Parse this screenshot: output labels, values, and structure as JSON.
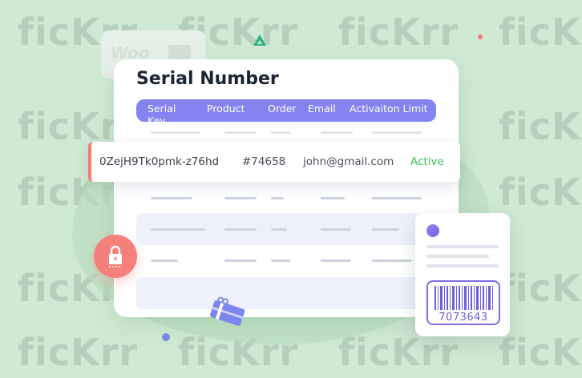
{
  "watermark": {
    "text": "ficKrr"
  },
  "woo_badge": {
    "text": "Woo"
  },
  "card": {
    "title": "Serial Number",
    "columns": [
      "Serial Key",
      "Product",
      "Order",
      "Email",
      "Activaiton Limit"
    ]
  },
  "highlight_row": {
    "serial_key": "0ZejH9Tk0pmk-z76hd",
    "order": "#74658",
    "email": "john@gmail.com",
    "status": "Active"
  },
  "barcode": {
    "number": "7073643"
  },
  "colors": {
    "background": "#cfe9d3",
    "header_bar": "#8383f1",
    "active_status": "#3fbf5d",
    "lock_badge": "#f57f7a",
    "row_accent": "#f27a74",
    "barcode_accent": "#7c6fe0"
  },
  "icons": [
    "lock-icon",
    "gift-card-icon",
    "barcode-icon",
    "triangle-shape",
    "avatar-dot"
  ]
}
